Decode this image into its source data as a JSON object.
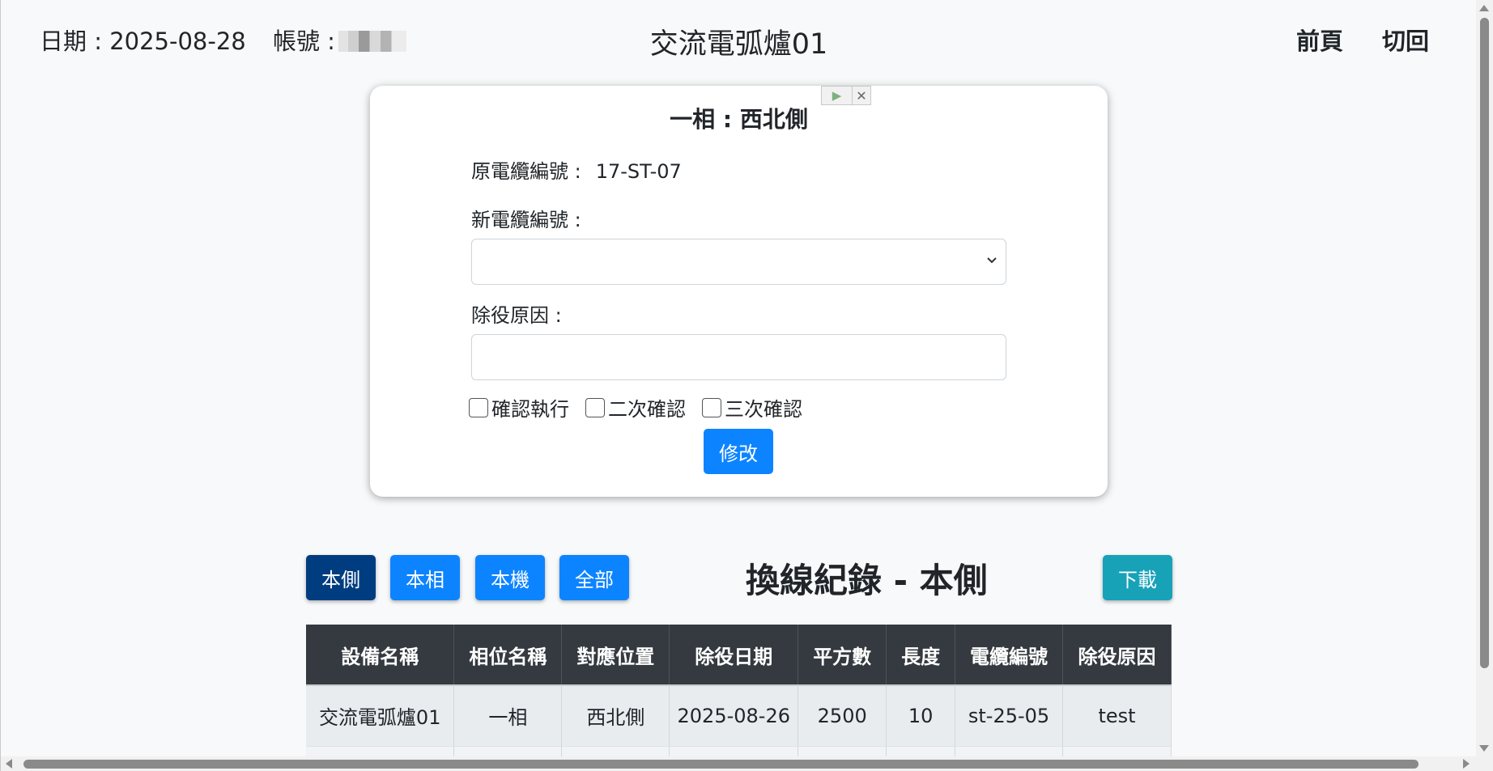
{
  "header": {
    "date_label": "日期 : 2025-08-28",
    "account_label": "帳號 :",
    "title": "交流電弧爐01",
    "prev_page": "前頁",
    "switch_back": "切回"
  },
  "form": {
    "title": "一相 : 西北側",
    "orig_cable_label": "原電纜編號 :",
    "orig_cable_value": "17-ST-07",
    "new_cable_label": "新電纜編號 :",
    "new_cable_value": "",
    "reason_label": "除役原因 :",
    "reason_value": "",
    "checkboxes": [
      "確認執行",
      "二次確認",
      "三次確認"
    ],
    "submit": "修改"
  },
  "filters": {
    "side": "本側",
    "phase": "本相",
    "machine": "本機",
    "all": "全部"
  },
  "colors": {
    "side_active": "#003d80",
    "filter_btn": "#0d84ff",
    "download_btn": "#17a2b8",
    "header_row": "#343a40"
  },
  "section_title": "換線紀錄 - 本側",
  "download": "下載",
  "table": {
    "headers": [
      "設備名稱",
      "相位名稱",
      "對應位置",
      "除役日期",
      "平方數",
      "長度",
      "電纜編號",
      "除役原因"
    ],
    "rows": [
      [
        "交流電弧爐01",
        "一相",
        "西北側",
        "2025-08-26",
        "2500",
        "10",
        "st-25-05",
        "test"
      ]
    ]
  },
  "icons": {
    "select_chevron": "chevron-down-icon",
    "ad_play": "play-icon",
    "ad_close": "close-icon"
  }
}
